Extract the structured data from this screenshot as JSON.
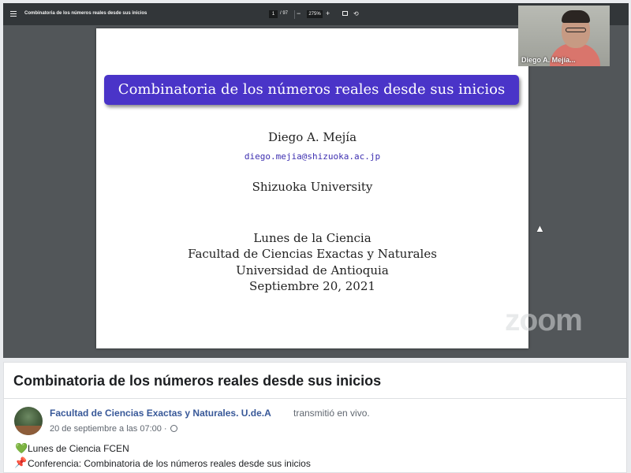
{
  "viewer": {
    "doc_title": "Combinatoria de los números reales desde sus inicios",
    "page_current": "1",
    "page_total": "/ 97",
    "zoom_out": "−",
    "zoom_level": "275%",
    "zoom_in": "+",
    "rotate_glyph": "⟲"
  },
  "slide": {
    "banner_title": "Combinatoria de los números reales desde sus inicios",
    "author": "Diego A. Mejía",
    "email": "diego.mejia@shizuoka.ac.jp",
    "university": "Shizuoka University",
    "event": "Lunes de la Ciencia",
    "faculty": "Facultad de Ciencias Exactas y Naturales",
    "host_university": "Universidad de Antioquia",
    "date": "Septiembre 20, 2021"
  },
  "participant": {
    "name": "Diego A. Mejía..."
  },
  "watermark": "zoom",
  "cursor_glyph": "▲",
  "post": {
    "title": "Combinatoria de los números reales desde sus inicios",
    "page_name": "Facultad de Ciencias Exactas y Naturales. U.de.A",
    "action": "transmitió en vivo.",
    "timestamp": "20 de septiembre a las 07:00 ·",
    "heart_glyph": "💚",
    "line1": "Lunes de Ciencia FCEN",
    "pin_glyph": "📌",
    "line2": "Conferencia: Combinatoria de los números reales desde sus inicios"
  },
  "colors": {
    "banner": "#4a34c8",
    "link": "#385898",
    "viewer_bg": "#525659",
    "toolbar_bg": "#323639"
  }
}
